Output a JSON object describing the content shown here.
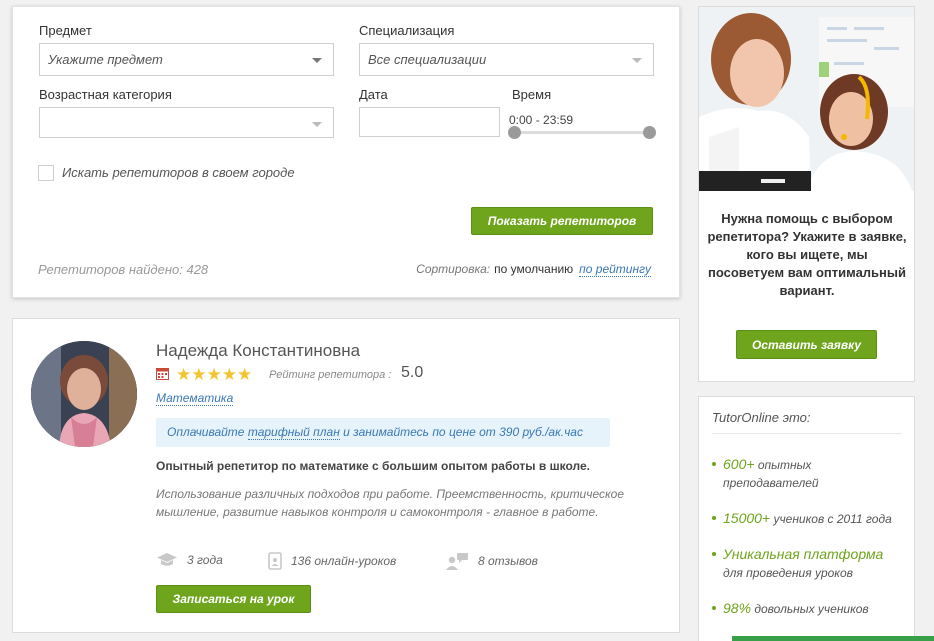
{
  "filter": {
    "subject_label": "Предмет",
    "subject_value": "Укажите предмет",
    "specialization_label": "Специализация",
    "specialization_value": "Все специализации",
    "age_label": "Возрастная категория",
    "age_value": "",
    "date_label": "Дата",
    "date_value": "",
    "time_label": "Время",
    "time_value": "0:00 - 23:59",
    "city_checkbox_label": "Искать репетиторов в своем городе",
    "city_checked": false,
    "show_button": "Показать репетиторов",
    "found_text": "Репетиторов найдено: 428",
    "sort_label": "Сортировка:",
    "sort_active": "по умолчанию",
    "sort_link": "по рейтингу"
  },
  "tutor": {
    "name": "Надежда Константиновна",
    "stars": "★★★★★",
    "rating_label": "Рейтинг репетитора :",
    "rating_value": "5.0",
    "subject": "Математика",
    "price_pre": "Оплачивайте",
    "price_link": "тарифный план",
    "price_post": "и занимайтесь по цене от 390 руб./ак.час",
    "headline": "Опытный репетитор по математике с большим опытом работы в школе.",
    "description": "Использование различных подходов при работе. Преемственность, критическое мышление, развитие навыков контроля и самоконтроля - главное в работе.",
    "experience": "3 года",
    "lessons": "136 онлайн-уроков",
    "reviews": "8 отзывов",
    "book_button": "Записаться на урок"
  },
  "promo": {
    "text": "Нужна помощь с выбором репетитора? Укажите в заявке, кого вы ищете, мы посоветуем вам оптимальный вариант.",
    "button": "Оставить заявку"
  },
  "info": {
    "title": "TutorOnline это:",
    "items": [
      {
        "highlight": "600+",
        "text": " опытных преподавателей"
      },
      {
        "highlight": "15000+",
        "text": " учеников с 2011 года"
      },
      {
        "highlight": "Уникальная платформа",
        "text": " для проведения уроков"
      },
      {
        "highlight": "98%",
        "text": " довольных учеников"
      }
    ]
  },
  "colors": {
    "accent_green": "#6fa51c",
    "link_blue": "#3a78b6",
    "star_yellow": "#f4c430",
    "price_bg": "#e6f3fa"
  }
}
